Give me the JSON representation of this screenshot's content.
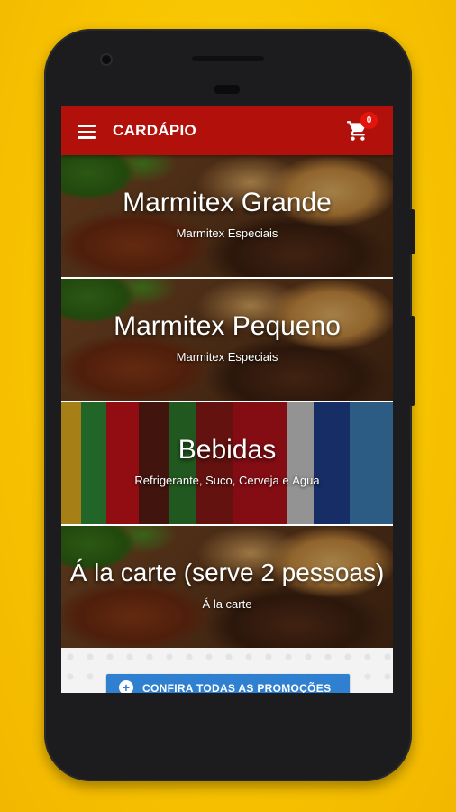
{
  "app": {
    "title": "CARDÁPIO",
    "cart_count": "0",
    "accent_color": "#b1100b"
  },
  "menu_items": [
    {
      "title": "Marmitex Grande",
      "subtitle": "Marmitex Especiais",
      "image": "food-photo"
    },
    {
      "title": "Marmitex Pequeno",
      "subtitle": "Marmitex Especiais",
      "image": "food-photo"
    },
    {
      "title": "Bebidas",
      "subtitle": "Refrigerante, Suco, Cerveja e Água",
      "image": "drinks-photo"
    },
    {
      "title": "Á la carte (serve 2 pessoas)",
      "subtitle": "Á la carte",
      "image": "food-photo"
    }
  ],
  "promo": {
    "label": "CONFIRA TODAS AS PROMOÇÕES",
    "color": "#2f80d1"
  },
  "icons": {
    "menu": "hamburger-menu-icon",
    "cart": "shopping-cart-icon",
    "promo": "plus-circle-icon"
  }
}
